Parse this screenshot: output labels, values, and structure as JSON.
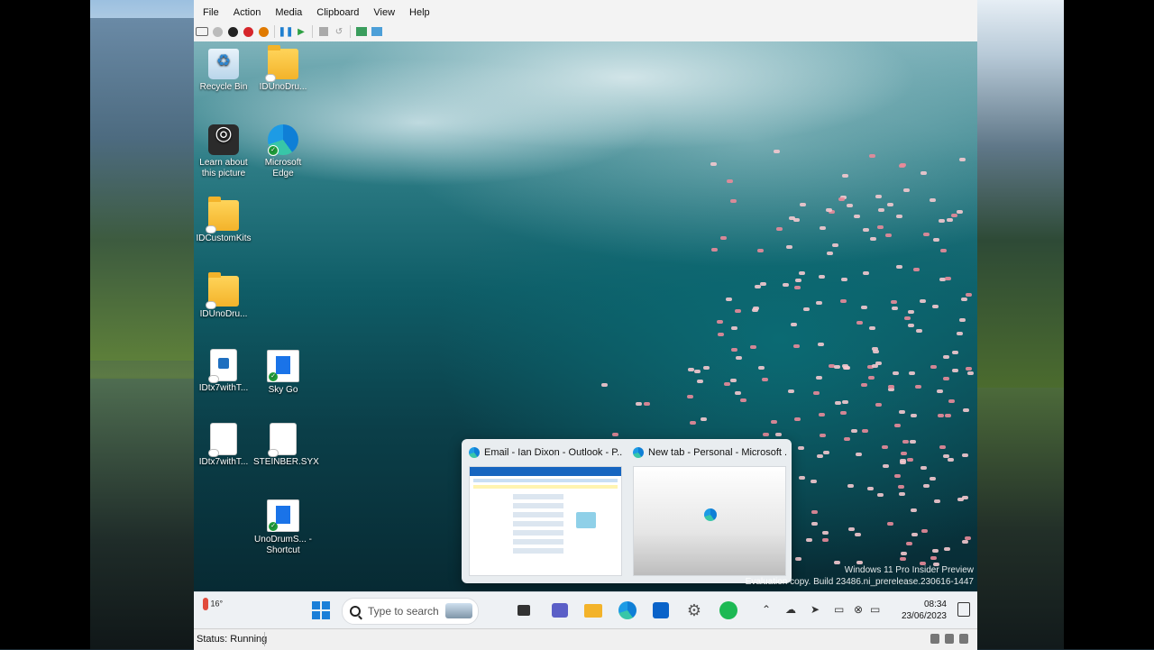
{
  "menu": [
    "File",
    "Action",
    "Media",
    "Clipboard",
    "View",
    "Help"
  ],
  "toolbar_icons": [
    "ctrl-alt-del-icon",
    "start-icon",
    "turn-off-icon",
    "shut-down-icon",
    "save-state-icon",
    "pause-icon",
    "resume-icon",
    "checkpoint-icon",
    "revert-icon",
    "enhanced-session-icon",
    "share-icon"
  ],
  "desktop_icons": [
    {
      "label": "Recycle Bin",
      "icon": "recycle-bin-icon"
    },
    {
      "label": "IDUnoDru...",
      "icon": "folder-icon"
    },
    {
      "label": "Learn about this picture",
      "icon": "learn-picture-icon"
    },
    {
      "label": "Microsoft Edge",
      "icon": "edge-icon"
    },
    {
      "label": "IDCustomKits",
      "icon": "folder-icon"
    },
    {
      "label": "IDUnoDru...",
      "icon": "folder-icon"
    },
    {
      "label": "IDtx7withT...",
      "icon": "media-file-icon"
    },
    {
      "label": "Sky Go",
      "icon": "shortcut-icon"
    },
    {
      "label": "IDtx7withT...",
      "icon": "document-icon"
    },
    {
      "label": "STEINBER.SYX",
      "icon": "document-icon"
    },
    {
      "label": "UnoDrumS... - Shortcut",
      "icon": "shortcut-icon"
    }
  ],
  "previews": [
    {
      "title": "Email - Ian Dixon - Outlook - P..."
    },
    {
      "title": "New tab - Personal - Microsoft ..."
    }
  ],
  "watermark": {
    "line1": "Windows 11 Pro Insider Preview",
    "line2": "Evaluation copy. Build 23486.ni_prerelease.230616-1447"
  },
  "taskbar": {
    "weather_temp": "16°",
    "search_placeholder": "Type to search",
    "apps": [
      "file-explorer-icon",
      "teams-icon",
      "folder-icon",
      "edge-icon",
      "store-icon",
      "settings-icon",
      "spotify-icon"
    ],
    "time": "08:34",
    "date": "23/06/2023"
  },
  "status": {
    "text": "Status: Running"
  }
}
